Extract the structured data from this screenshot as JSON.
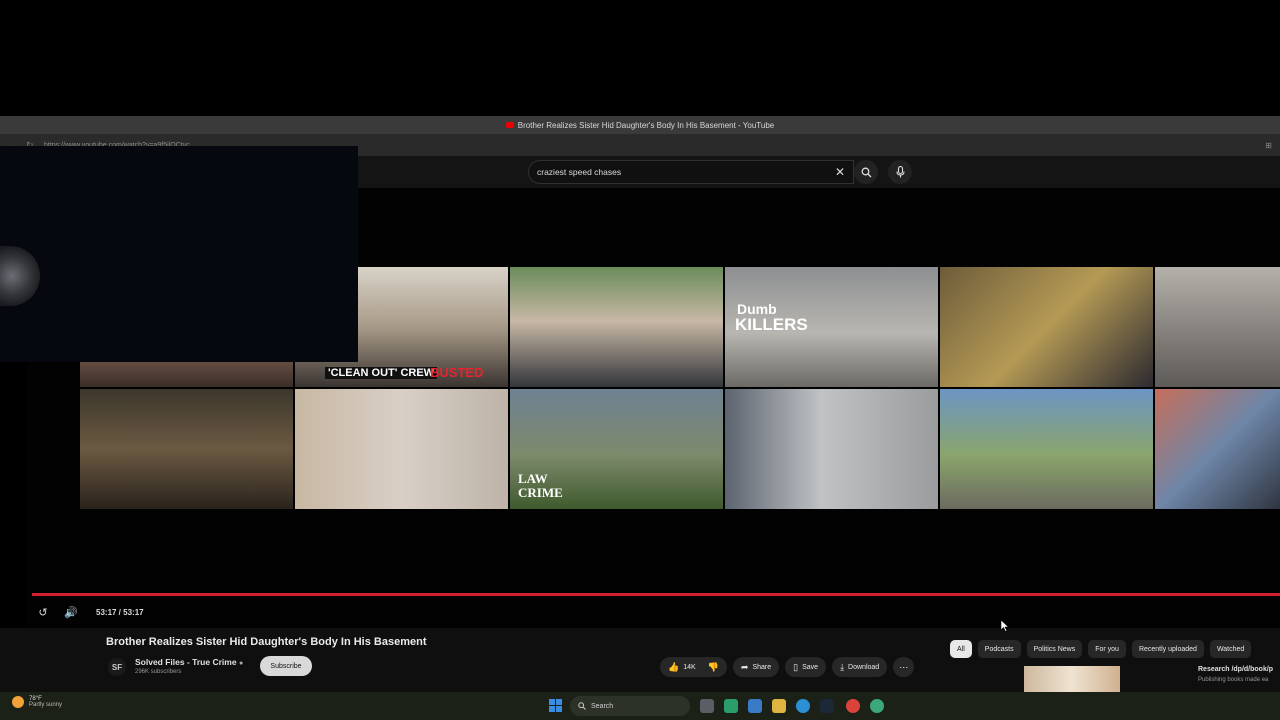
{
  "browser": {
    "window_title": "Brother Realizes Sister Hid Daughter's Body In His Basement - YouTube",
    "url": "https://www.youtube.com/watch?v=a9f5jlOCtvc"
  },
  "search": {
    "query": "craziest speed chases"
  },
  "tiles": [
    {
      "caption": "'CLEAN OUT' CREW",
      "caption2": "BUSTED"
    },
    {
      "caption": "Dumb",
      "caption2": "KILLERS"
    },
    {
      "caption": "LAW",
      "caption2": "CRIME"
    }
  ],
  "player": {
    "time": "53:17 / 53:17",
    "progress": 1.0
  },
  "video": {
    "title": "Brother Realizes Sister Hid Daughter's Body In His Basement",
    "channel_initials": "SF",
    "channel": "Solved Files - True Crime",
    "subscribers": "296K subscribers",
    "subscribe_label": "Subscribe",
    "likes": "14K",
    "share_label": "Share",
    "save_label": "Save",
    "download_label": "Download"
  },
  "chips": [
    "All",
    "Podcasts",
    "Politics News",
    "For you",
    "Recently uploaded",
    "Watched"
  ],
  "recommended": {
    "title": "Research /dp/d/book/p",
    "channel": "Publishing books made ea"
  },
  "taskbar": {
    "temperature": "78°F",
    "condition": "Partly sunny",
    "search_label": "Search"
  },
  "colors": {
    "progress": "#d4202c",
    "background": "#0f0f0f"
  }
}
